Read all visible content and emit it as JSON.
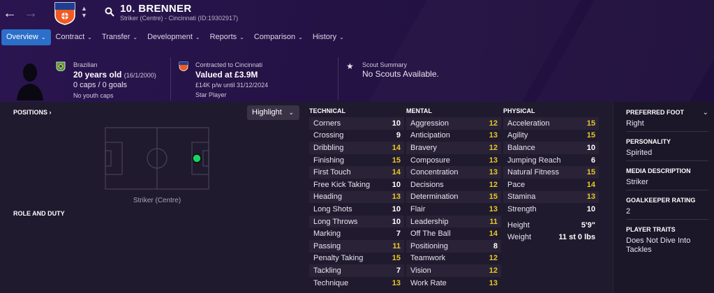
{
  "header": {
    "player_name": "10. BRENNER",
    "player_subtitle": "Striker (Centre) - Cincinnati (ID:19302917)"
  },
  "tabs": [
    {
      "label": "Overview"
    },
    {
      "label": "Contract"
    },
    {
      "label": "Transfer"
    },
    {
      "label": "Development"
    },
    {
      "label": "Reports"
    },
    {
      "label": "Comparison"
    },
    {
      "label": "History"
    }
  ],
  "bio": {
    "nationality": "Brazilian",
    "age": "20 years old",
    "dob": "(16/1/2000)",
    "caps": "0 caps / 0 goals",
    "youth_caps": "No youth caps"
  },
  "contract": {
    "club_line": "Contracted to Cincinnati",
    "value": "Valued at £3.9M",
    "wage": "£14K p/w until 31/12/2024",
    "status": "Star Player"
  },
  "scout": {
    "title": "Scout Summary",
    "text": "No Scouts Available."
  },
  "positions": {
    "label": "POSITIONS",
    "highlight_label": "Highlight",
    "caption": "Striker (Centre)",
    "role_label": "ROLE AND DUTY"
  },
  "technical": {
    "title": "TECHNICAL",
    "rows": [
      {
        "name": "Corners",
        "value": "10"
      },
      {
        "name": "Crossing",
        "value": "9"
      },
      {
        "name": "Dribbling",
        "value": "14"
      },
      {
        "name": "Finishing",
        "value": "15"
      },
      {
        "name": "First Touch",
        "value": "14"
      },
      {
        "name": "Free Kick Taking",
        "value": "10"
      },
      {
        "name": "Heading",
        "value": "13"
      },
      {
        "name": "Long Shots",
        "value": "10"
      },
      {
        "name": "Long Throws",
        "value": "10"
      },
      {
        "name": "Marking",
        "value": "7"
      },
      {
        "name": "Passing",
        "value": "11"
      },
      {
        "name": "Penalty Taking",
        "value": "15"
      },
      {
        "name": "Tackling",
        "value": "7"
      },
      {
        "name": "Technique",
        "value": "13"
      }
    ]
  },
  "mental": {
    "title": "MENTAL",
    "rows": [
      {
        "name": "Aggression",
        "value": "12"
      },
      {
        "name": "Anticipation",
        "value": "13"
      },
      {
        "name": "Bravery",
        "value": "12"
      },
      {
        "name": "Composure",
        "value": "13"
      },
      {
        "name": "Concentration",
        "value": "13"
      },
      {
        "name": "Decisions",
        "value": "12"
      },
      {
        "name": "Determination",
        "value": "15"
      },
      {
        "name": "Flair",
        "value": "13"
      },
      {
        "name": "Leadership",
        "value": "11"
      },
      {
        "name": "Off The Ball",
        "value": "14"
      },
      {
        "name": "Positioning",
        "value": "8"
      },
      {
        "name": "Teamwork",
        "value": "12"
      },
      {
        "name": "Vision",
        "value": "12"
      },
      {
        "name": "Work Rate",
        "value": "13"
      }
    ]
  },
  "physical": {
    "title": "PHYSICAL",
    "rows": [
      {
        "name": "Acceleration",
        "value": "15"
      },
      {
        "name": "Agility",
        "value": "15"
      },
      {
        "name": "Balance",
        "value": "10"
      },
      {
        "name": "Jumping Reach",
        "value": "6"
      },
      {
        "name": "Natural Fitness",
        "value": "15"
      },
      {
        "name": "Pace",
        "value": "14"
      },
      {
        "name": "Stamina",
        "value": "13"
      },
      {
        "name": "Strength",
        "value": "10"
      }
    ],
    "height_label": "Height",
    "height_value": "5'9\"",
    "weight_label": "Weight",
    "weight_value": "11 st 0 lbs"
  },
  "sidebar": {
    "preferred_foot_h": "PREFERRED FOOT",
    "preferred_foot_v": "Right",
    "personality_h": "PERSONALITY",
    "personality_v": "Spirited",
    "media_h": "MEDIA DESCRIPTION",
    "media_v": "Striker",
    "gk_h": "GOALKEEPER RATING",
    "gk_v": "2",
    "traits_h": "PLAYER TRAITS",
    "traits_v": "Does Not Dive Into Tackles"
  },
  "colors": {
    "accent": "#2b6fc9",
    "highlight_value": "#e6c828",
    "position_dot": "#19d463"
  }
}
